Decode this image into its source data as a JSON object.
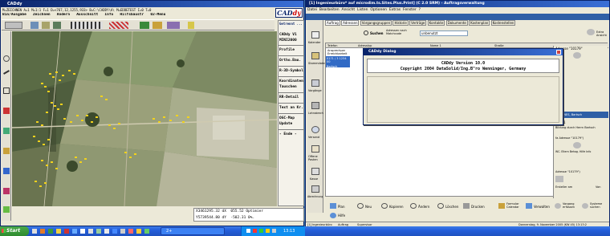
{
  "cad": {
    "title": "CADdy",
    "status_line": "M=ZEICHNEN A=1 M=1:1 F=1 D=<767,12,1255,933> B=C:\\CADDY\\A\\ M=EDDETEST I=0 T=0",
    "menu": [
      "Bin/Ausgabe",
      "Zeichnen",
      "Ändern",
      "Ausschnitt",
      "Info",
      "Hilfsbaustr",
      "02-Menü"
    ],
    "side_panel": [
      {
        "text": "Getrennt ...",
        "kind": "head"
      },
      {
        "text": "CADdy V1",
        "kind": "item"
      },
      {
        "text": "MINI2000",
        "kind": "item"
      },
      {
        "text": "Profile",
        "kind": "item"
      },
      {
        "text": "Ortho.Bau.",
        "kind": "item"
      },
      {
        "text": "R-3D-Symbol",
        "kind": "item"
      },
      {
        "text": "Koordinaten",
        "kind": "item"
      },
      {
        "text": "Tauschen",
        "kind": "item"
      },
      {
        "text": "RR-Detail",
        "kind": "item"
      },
      {
        "text": "Text an Kr.",
        "kind": "item"
      },
      {
        "text": "OGC-Map",
        "kind": "item"
      },
      {
        "text": "Update",
        "kind": "item"
      },
      {
        "text": "- Ende -",
        "kind": "item"
      }
    ],
    "coord_row1": [
      "X3461295.32 dX",
      "055.52 Optimier"
    ],
    "coord_row2": [
      "Y5739544.80 dY",
      "-502.31 0%."
    ],
    "accent_blue": "#0a246a",
    "photo_green": "#6b7a55"
  },
  "taskbar": {
    "start_label": "Start",
    "clock": "13:13",
    "buttons": [
      "2+"
    ],
    "color": "#245edb"
  },
  "right_window": {
    "title": "[1] Ingenieurbüro* auf microdim.ts.Sites.Plus.Print] (C 2.0 SRM) - Auftragsverwaltung",
    "menu": [
      "Datei",
      "Bearbeiten",
      "Ansicht",
      "Listen",
      "Optionen",
      "Extras",
      "Fenster",
      "?"
    ],
    "tabs": [
      "Auftrag",
      "Adressen",
      "Vorgangsgruppen",
      "Historie",
      "Verträge",
      "Kontakte",
      "Dokumente",
      "Kostenplan",
      "Kostenstellen"
    ],
    "search_label": "Suchen",
    "search_value": "Adressen nach Matchcode",
    "filter_value": "unbenutzt",
    "side_items": [
      "Kalender",
      "Stammdaten",
      "Vorgänge",
      "Lohnabrechnungen",
      "Versand",
      "Offene Posten",
      "Kasse",
      "Abrechnung"
    ],
    "grid_header": [
      "Telefon",
      "Adresstyp",
      "Name 1",
      "Straße"
    ],
    "grid_first_cells": [
      "Ansprechpar Erreichbarkeit",
      "0171 / 3 1234 00",
      "Bartsch"
    ],
    "right_pane_labels": [
      "Adresse \"10179\"",
      "INTERNES, Bartsch",
      "00021",
      "Bildung durch Herrn Bartsch",
      "fa Adresse \"10179\")",
      "WC. Eltern Behag. Hilfe Info",
      "Adresse \"10179\")",
      "Ersteller am",
      "Von"
    ],
    "footer_buttons": [
      "Plan",
      "Neu",
      "Kopieren",
      "Ändern",
      "Löschen",
      "Drucken",
      "Formular Calendar",
      "Verwalten",
      "Vorgang erfassen",
      "Systeme suchen",
      "Hilfe"
    ],
    "extra_button": "Extra Ansicht",
    "status": [
      "[1] Ingenieurbüro",
      "Auftrag",
      "Supervisor"
    ],
    "status_date": "Donnerstag, 9. November 2005 (KW 45)  13:13:2"
  },
  "dialog": {
    "title": "CADdy Dialog",
    "line1": "CADdy Version 10.0",
    "line2": "Copyright 2004 DataSolid/Ing.B\"ro Wenninger, Germany"
  }
}
